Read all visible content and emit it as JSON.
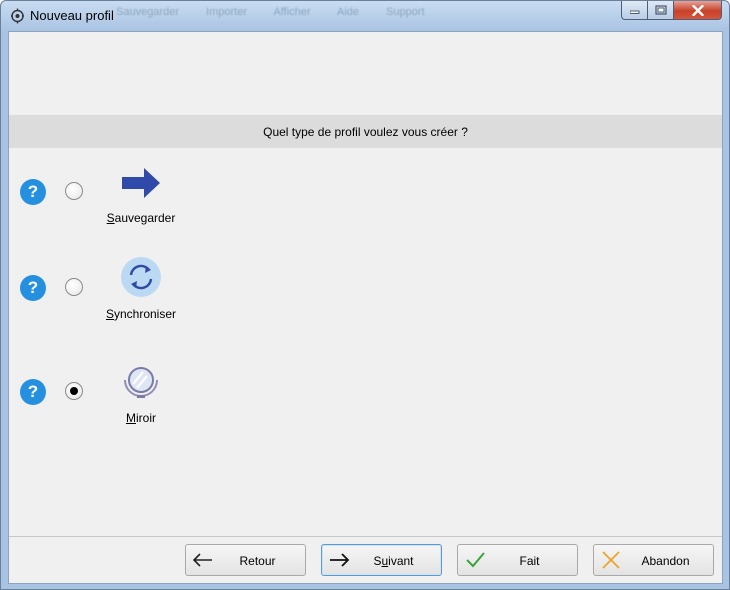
{
  "window": {
    "title": "Nouveau profil",
    "background_menu": "Sauvegarder Importer Afficher Aide Support"
  },
  "question": "Quel type de profil voulez vous créer ?",
  "options": [
    {
      "accel": "S",
      "rest": "auvegarder",
      "icon": "arrow-right-icon",
      "selected": false
    },
    {
      "accel": "S",
      "rest": "ynchroniser",
      "icon": "sync-icon",
      "selected": false
    },
    {
      "accel": "M",
      "rest": "iroir",
      "icon": "mirror-icon",
      "selected": true
    }
  ],
  "help_symbol": "?",
  "buttons": {
    "back": "Retour",
    "next_pre": "S",
    "next_accel": "u",
    "next_post": "ivant",
    "done": "Fait",
    "abort": "Abandon"
  },
  "colors": {
    "help_blue": "#2690e0",
    "arrow_blue": "#2f4aa8",
    "check_green": "#3aa23a",
    "cancel_orange": "#f0a020"
  }
}
